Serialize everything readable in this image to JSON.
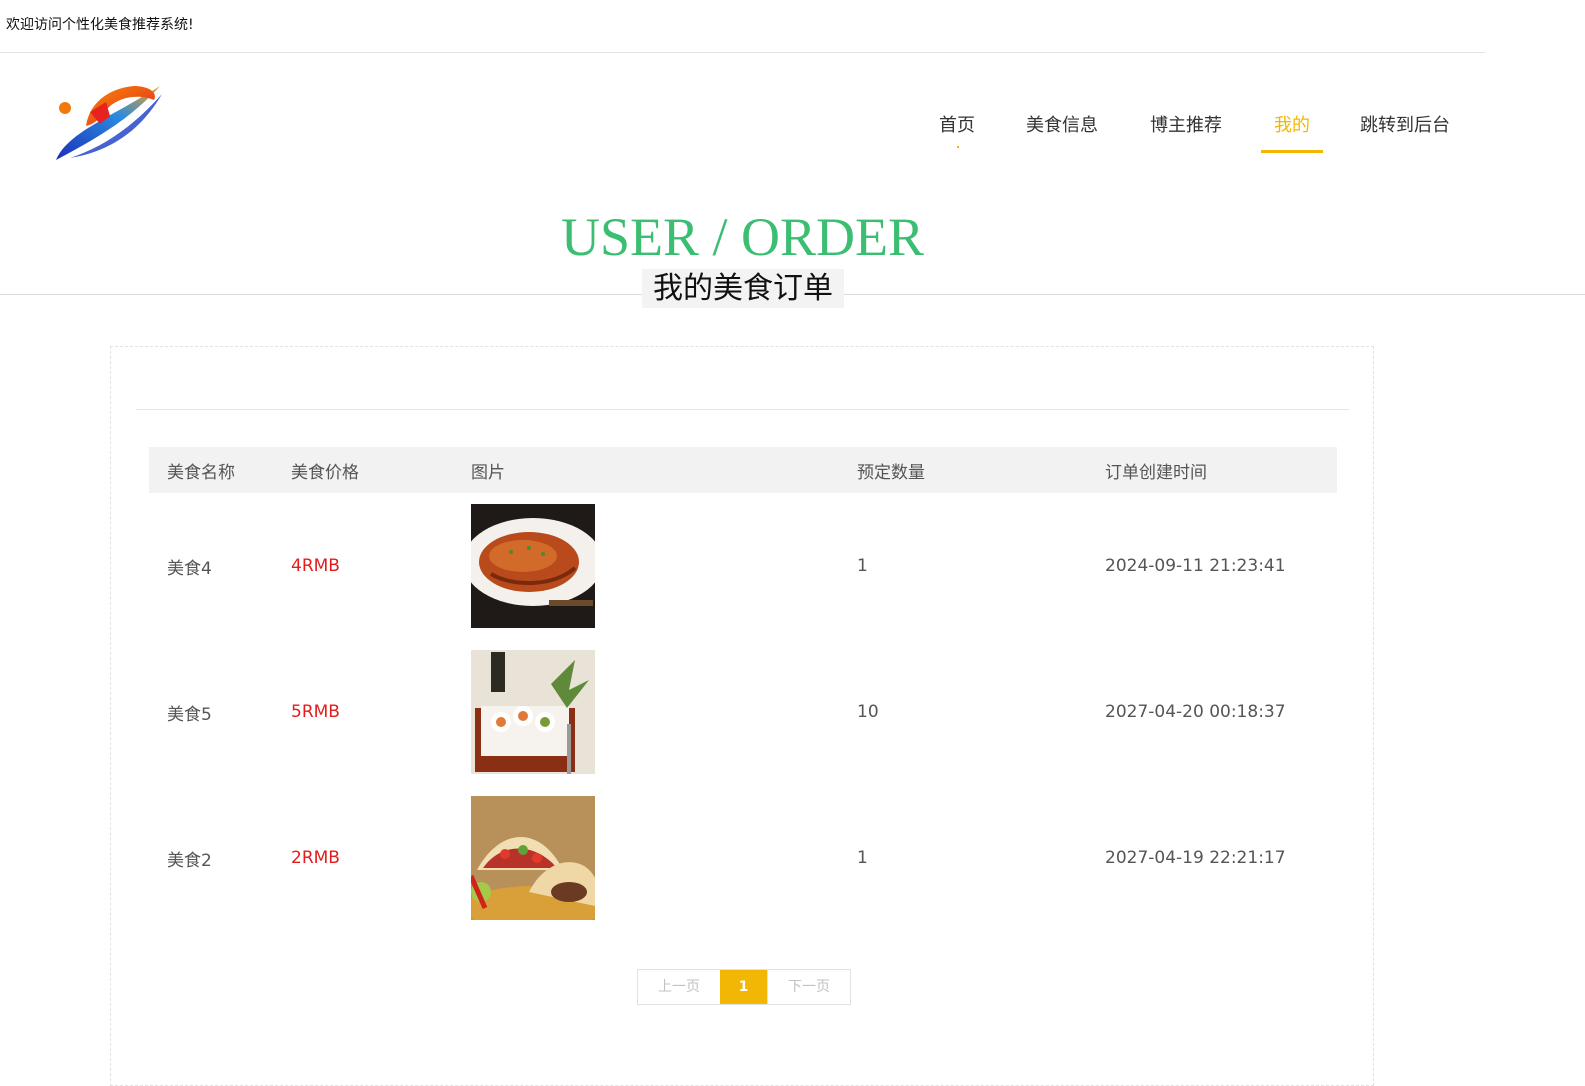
{
  "topbar": {
    "welcome": "欢迎访问个性化美食推荐系统!"
  },
  "nav": {
    "items": [
      {
        "label": "首页"
      },
      {
        "label": "美食信息"
      },
      {
        "label": "博主推荐"
      },
      {
        "label": "我的"
      },
      {
        "label": "跳转到后台"
      }
    ],
    "active_label": "我的"
  },
  "hero": {
    "title": "USER / ORDER",
    "subtitle": "我的美食订单"
  },
  "table": {
    "headers": {
      "name": "美食名称",
      "price": "美食价格",
      "image": "图片",
      "quantity": "预定数量",
      "created": "订单创建时间"
    },
    "rows": [
      {
        "name": "美食4",
        "price": "4RMB",
        "image_icon": "fish-dish-photo",
        "quantity": "1",
        "created": "2024-09-11 21:23:41"
      },
      {
        "name": "美食5",
        "price": "5RMB",
        "image_icon": "sushi-platter-photo",
        "quantity": "10",
        "created": "2027-04-20 00:18:37"
      },
      {
        "name": "美食2",
        "price": "2RMB",
        "image_icon": "tacos-photo",
        "quantity": "1",
        "created": "2027-04-19 22:21:17"
      }
    ]
  },
  "pager": {
    "prev": "上一页",
    "current": "1",
    "next": "下一页"
  },
  "colors": {
    "accent": "#f2b705",
    "hero_title": "#3bbd72",
    "price": "#e41c1c"
  }
}
